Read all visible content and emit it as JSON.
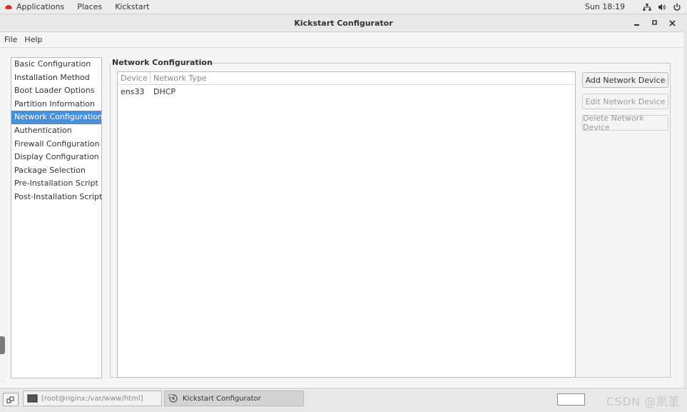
{
  "topbar": {
    "applications": "Applications",
    "places": "Places",
    "app_name": "Kickstart",
    "clock": "Sun 18:19"
  },
  "window": {
    "title": "Kickstart Configurator",
    "minimize": "_",
    "maximize": "▫",
    "close": "×"
  },
  "menubar": {
    "file": "File",
    "help": "Help"
  },
  "sidebar": {
    "items": [
      {
        "label": "Basic Configuration"
      },
      {
        "label": "Installation Method"
      },
      {
        "label": "Boot Loader Options"
      },
      {
        "label": "Partition Information"
      },
      {
        "label": "Network Configuration",
        "selected": true
      },
      {
        "label": "Authentication"
      },
      {
        "label": "Firewall Configuration"
      },
      {
        "label": "Display Configuration"
      },
      {
        "label": "Package Selection"
      },
      {
        "label": "Pre-Installation Script"
      },
      {
        "label": "Post-Installation Script"
      }
    ]
  },
  "section": {
    "title": "Network Configuration"
  },
  "table": {
    "columns": [
      "Device",
      "Network Type"
    ],
    "rows": [
      {
        "device": "ens33",
        "type": "DHCP"
      }
    ]
  },
  "buttons": {
    "add": "Add Network Device",
    "edit": "Edit Network Device",
    "delete": "Delete Network Device"
  },
  "taskbar": {
    "terminal_task": "[root@nginx:/var/www/html]",
    "active_task": "Kickstart Configurator",
    "watermark": "CSDN @夙堇"
  },
  "colors": {
    "selection": "#4a90d9",
    "brand_hat": "#d4302a"
  }
}
